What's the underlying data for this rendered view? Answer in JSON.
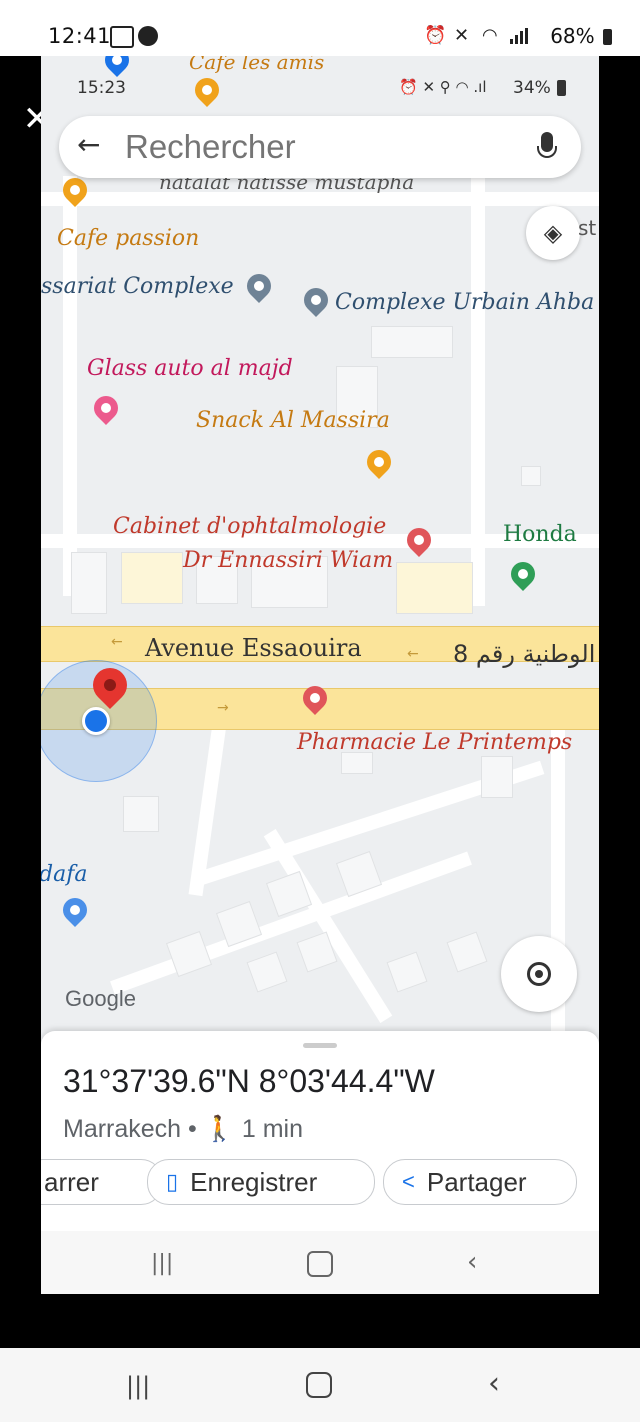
{
  "outer_status": {
    "time": "12:41",
    "battery": "68%"
  },
  "inner_status": {
    "time": "15:23",
    "battery": "34%"
  },
  "search": {
    "placeholder": "Rechercher"
  },
  "map_labels": {
    "cafe_top": "Cafe les amis",
    "patisserie": "natalat natisse mustapha",
    "cafe_passion": "Cafe passion",
    "commissariat": "ssariat Complexe",
    "complexe_urbain": "Complexe Urbain Ahba",
    "glass_auto": "Glass auto al majd",
    "snack": "Snack Al Massira",
    "cabinet_line1": "Cabinet d'ophtalmologie",
    "cabinet_line2": "Dr Ennassiri Wiam",
    "honda": "Honda",
    "avenue": "Avenue Essaouira",
    "arabic_road": "الوطنية رقم 8",
    "pharmacie": "Pharmacie Le Printemps",
    "dafa": "dafa",
    "layers_partial": "st",
    "google": "Google"
  },
  "place": {
    "coordinates": "31°37'39.6\"N 8°03'44.4\"W",
    "city": "Marrakech",
    "walk_time": "1 min"
  },
  "actions": {
    "start": "arrer",
    "save": "Enregistrer",
    "share": "Partager"
  },
  "colors": {
    "road_yellow": "#fbe49a",
    "food_orange": "#f0a21b",
    "health_red": "#e0555a",
    "shop_green": "#2f9e57",
    "label_brown": "#c57a12",
    "label_red": "#c0392b",
    "location_blue": "#1a73e8"
  }
}
